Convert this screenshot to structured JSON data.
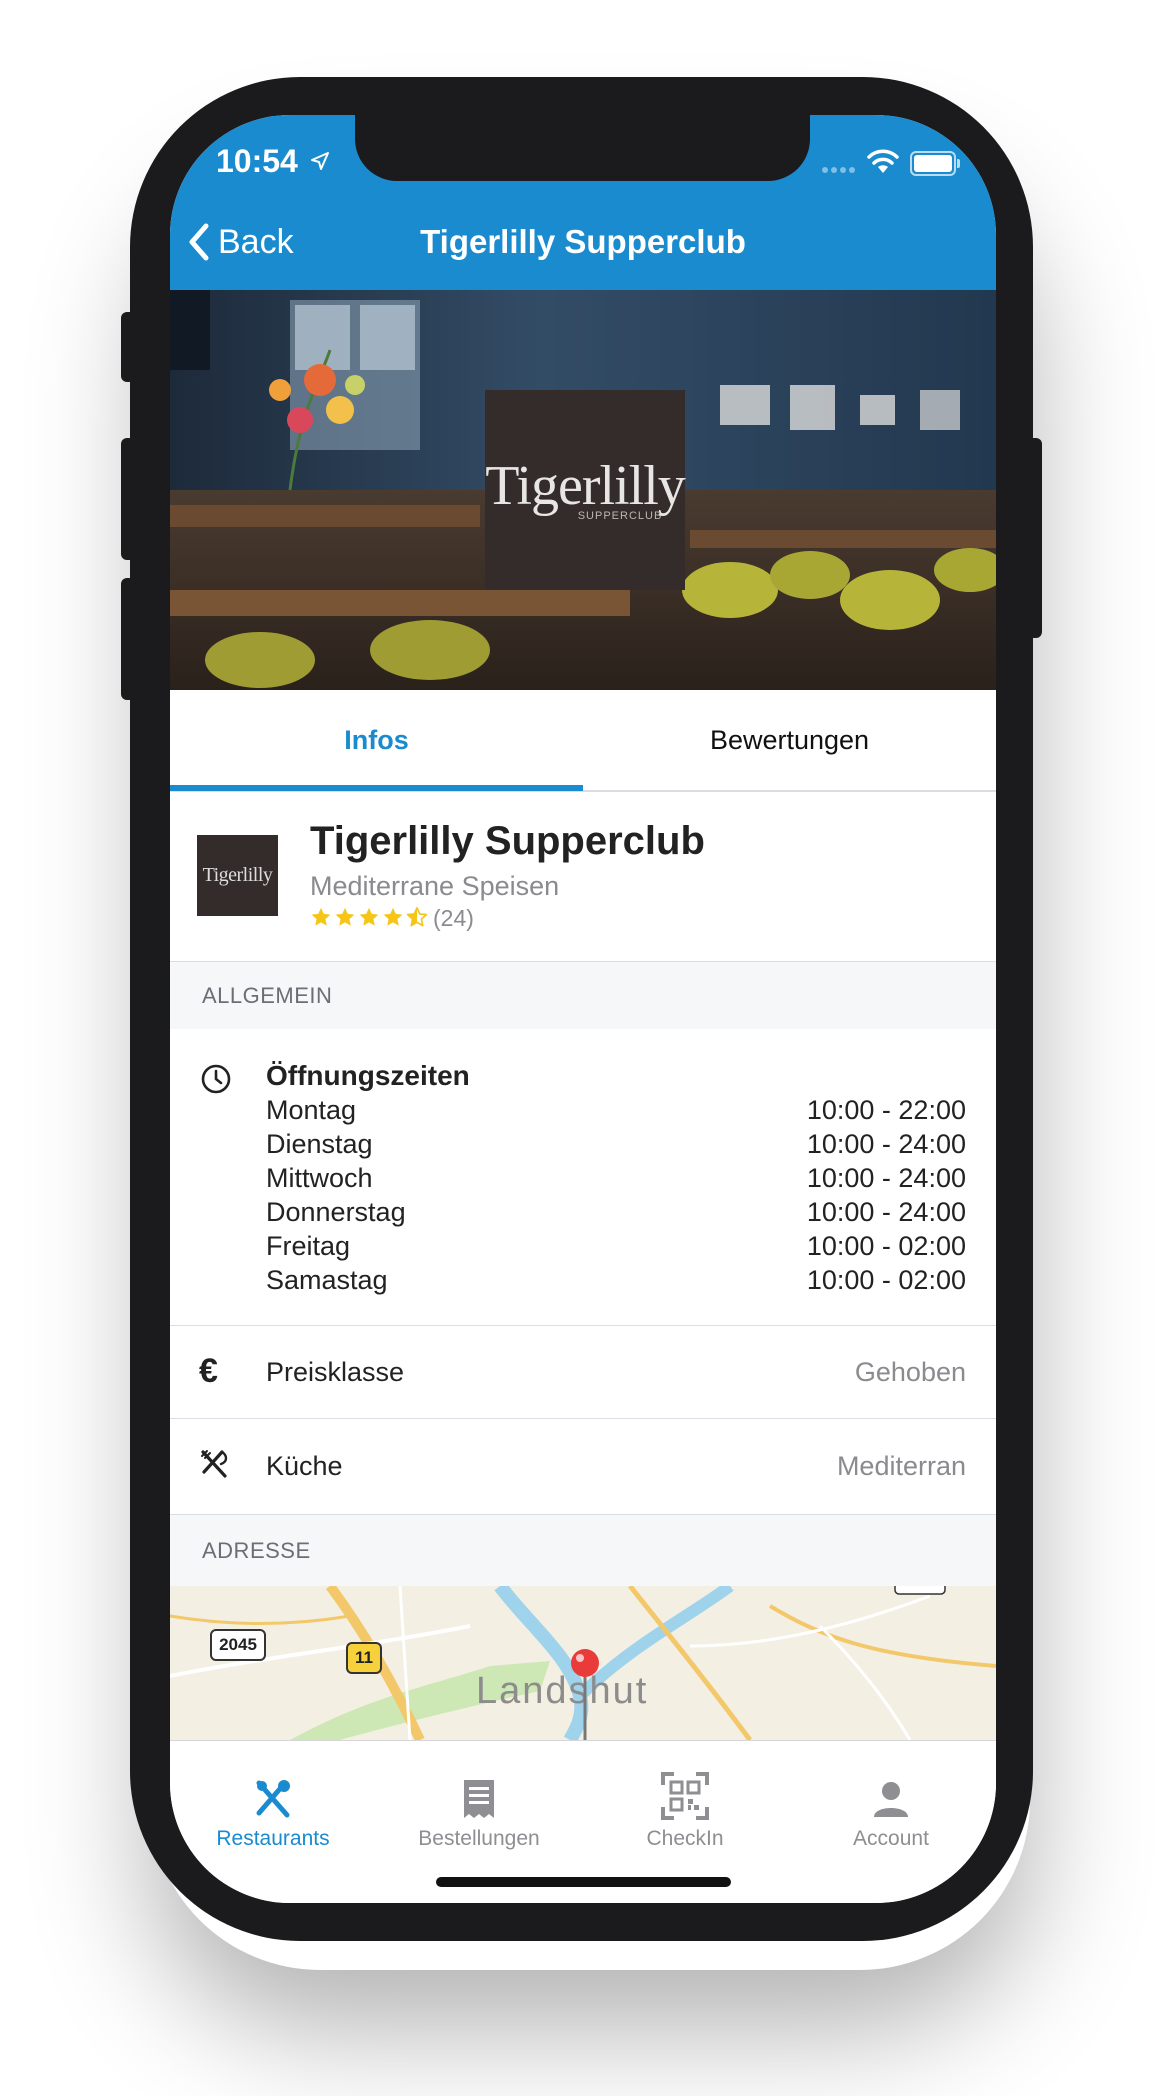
{
  "status_bar": {
    "time": "10:54"
  },
  "nav": {
    "back_label": "Back",
    "title": "Tigerlilly Supperclub"
  },
  "hero": {
    "logo_text": "Tigerlilly",
    "logo_subtext": "SUPPERCLUB"
  },
  "tabs": [
    {
      "label": "Infos",
      "active": true
    },
    {
      "label": "Bewertungen",
      "active": false
    }
  ],
  "restaurant": {
    "logo_text": "Tigerlilly",
    "name": "Tigerlilly Supperclub",
    "category": "Mediterrane Speisen",
    "rating": 4.5,
    "rating_max": 5,
    "review_count": "(24)"
  },
  "sections": {
    "general": "ALLGEMEIN",
    "address": "ADRESSE"
  },
  "opening_hours": {
    "title": "Öffnungszeiten",
    "rows": [
      {
        "day": "Montag",
        "time": "10:00 - 22:00"
      },
      {
        "day": "Dienstag",
        "time": "10:00 - 24:00"
      },
      {
        "day": "Mittwoch",
        "time": "10:00 - 24:00"
      },
      {
        "day": "Donnerstag",
        "time": "10:00 - 24:00"
      },
      {
        "day": "Freitag",
        "time": "10:00 - 02:00"
      },
      {
        "day": "Samastag",
        "time": "10:00 - 02:00"
      }
    ]
  },
  "price_class": {
    "label": "Preisklasse",
    "value": "Gehoben"
  },
  "cuisine": {
    "label": "Küche",
    "value": "Mediterran"
  },
  "map": {
    "city_label": "Landshut",
    "road_labels": [
      "2045",
      "11"
    ]
  },
  "tab_bar": [
    {
      "label": "Restaurants",
      "icon": "cutlery-icon",
      "active": true
    },
    {
      "label": "Bestellungen",
      "icon": "receipt-icon",
      "active": false
    },
    {
      "label": "CheckIn",
      "icon": "qr-code-icon",
      "active": false
    },
    {
      "label": "Account",
      "icon": "person-icon",
      "active": false
    }
  ],
  "colors": {
    "accent": "#1a8bcf",
    "star": "#f5c518",
    "section_bg": "#f5f7f9",
    "inactive_icon": "#8e8e93"
  }
}
